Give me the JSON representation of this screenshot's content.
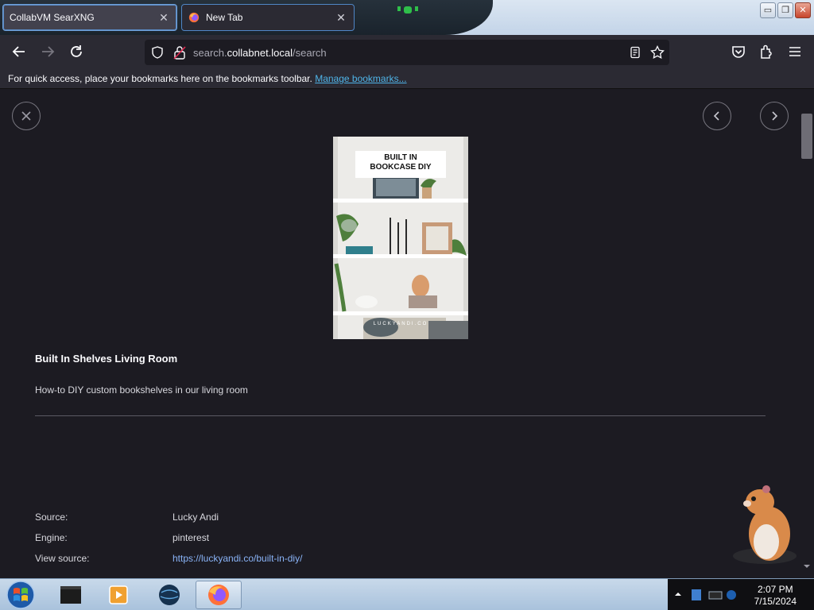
{
  "window": {
    "tabs": [
      {
        "label": "CollabVM SearXNG",
        "active": true
      },
      {
        "label": "New Tab",
        "active": false
      }
    ],
    "controls": {
      "minimize": "▭",
      "restore": "❐",
      "close": "✕"
    }
  },
  "navbar": {
    "url_prefix": "search.",
    "url_host": "collabnet.local",
    "url_path": "/search"
  },
  "bookmarks_bar": {
    "message": "For quick access, place your bookmarks here on the bookmarks toolbar.",
    "link": "Manage bookmarks..."
  },
  "preview": {
    "image_caption_line1": "BUILT IN",
    "image_caption_line2": "BOOKCASE DIY",
    "watermark": "LUCKYANDI.CO"
  },
  "result": {
    "title": "Built In Shelves Living Room",
    "description": "How-to DIY custom bookshelves in our living room",
    "source_label": "Source:",
    "source_value": "Lucky Andi",
    "engine_label": "Engine:",
    "engine_value": "pinterest",
    "view_source_label": "View source:",
    "view_source_value": "https://luckyandi.co/built-in-diy/"
  },
  "taskbar": {
    "time": "2:07 PM",
    "date": "7/15/2024"
  },
  "colors": {
    "content_bg": "#1c1b22",
    "chrome_bg": "#2b2a33",
    "link": "#8ab4f8",
    "bookmark_link": "#4fb4e8"
  }
}
